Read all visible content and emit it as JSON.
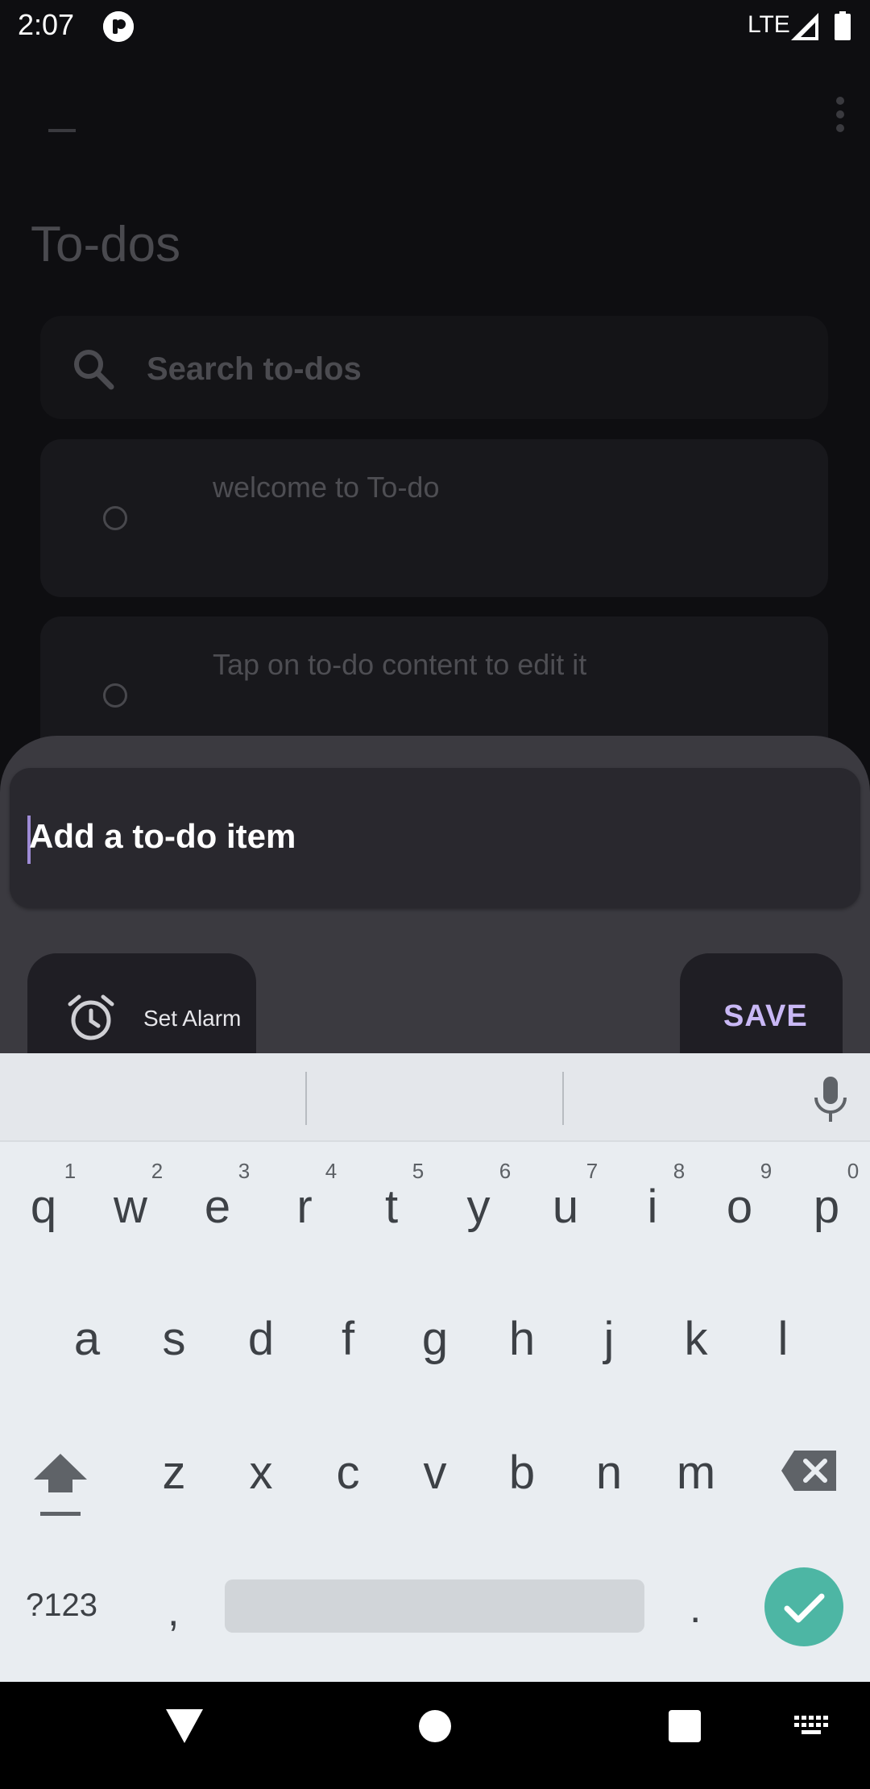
{
  "status_bar": {
    "time": "2:07",
    "network": "LTE",
    "notification_icon": "app-notification-icon",
    "signal_icon": "signal-icon",
    "battery_icon": "battery-icon"
  },
  "app_bar": {
    "menu_icon": "menu-icon",
    "overflow_icon": "more-vertical-icon"
  },
  "page": {
    "title": "To-dos"
  },
  "search": {
    "placeholder": "Search to-dos",
    "icon": "search-icon"
  },
  "todos": [
    {
      "text": "welcome to To-do"
    },
    {
      "text": "Tap on to-do content to edit it"
    }
  ],
  "sheet": {
    "input_value": "Add a to-do item",
    "alarm_label": "Set Alarm",
    "save_label": "SAVE"
  },
  "keyboard": {
    "numbers": [
      "1",
      "2",
      "3",
      "4",
      "5",
      "6",
      "7",
      "8",
      "9",
      "0"
    ],
    "row1": [
      "q",
      "w",
      "e",
      "r",
      "t",
      "y",
      "u",
      "i",
      "o",
      "p"
    ],
    "row2": [
      "a",
      "s",
      "d",
      "f",
      "g",
      "h",
      "j",
      "k",
      "l"
    ],
    "row3": [
      "z",
      "x",
      "c",
      "v",
      "b",
      "n",
      "m"
    ],
    "symbols_key": "?123",
    "comma": ",",
    "period": "."
  },
  "colors": {
    "accent": "#c9b8f5",
    "enter": "#4db6a4",
    "sheet": "#3b3a40",
    "background": "#0e0e11"
  }
}
